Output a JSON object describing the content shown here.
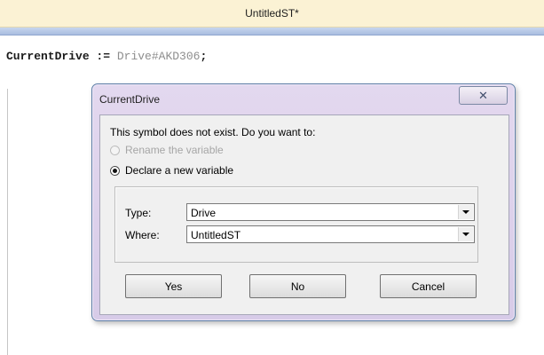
{
  "window": {
    "title": "UntitledST*"
  },
  "editor": {
    "code": {
      "variable": "CurrentDrive",
      "operator": " := ",
      "value": "Drive#AKD306",
      "terminator": ";"
    }
  },
  "dialog": {
    "title": "CurrentDrive",
    "close_glyph": "✕",
    "prompt": "This symbol does not exist. Do you want to:",
    "options": [
      {
        "label": "Rename the variable",
        "enabled": false,
        "selected": false
      },
      {
        "label": "Declare a new variable",
        "enabled": true,
        "selected": true
      }
    ],
    "type_label": "Type:",
    "type_value": "Drive",
    "where_label": "Where:",
    "where_value": "UntitledST",
    "buttons": {
      "yes": "Yes",
      "no": "No",
      "cancel": "Cancel"
    }
  },
  "colors": {
    "titlebar": "#fbf2d4",
    "accentbar": "#a9bde0",
    "dialog_frame": "#d7cbe8",
    "code_type_gray": "#8e8e8e"
  }
}
